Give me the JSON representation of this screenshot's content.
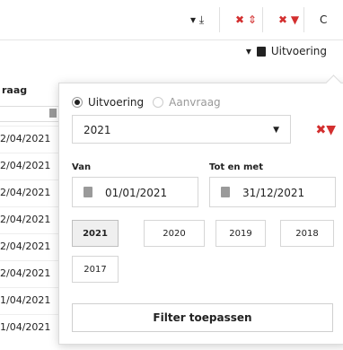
{
  "toolbar": {
    "export_icon_label": "▾ ⤓",
    "sort_icon_label": "✖ ⇕",
    "filter_icon_label": "✖ ▼",
    "refresh_icon_label": "C"
  },
  "subbar": {
    "dropdown_arrow": "▾",
    "calendar_icon": "calendar",
    "mode_label": "Uitvoering"
  },
  "grid": {
    "column_header": "raag",
    "rows": [
      "2/04/2021",
      "2/04/2021",
      "2/04/2021",
      "2/04/2021",
      "2/04/2021",
      "2/04/2021",
      "1/04/2021",
      "1/04/2021"
    ]
  },
  "popup": {
    "radio_options": [
      {
        "label": "Uitvoering",
        "selected": true
      },
      {
        "label": "Aanvraag",
        "selected": false
      }
    ],
    "year_select": {
      "value": "2021"
    },
    "clear_filter_label": "✖▼",
    "from_label": "Van",
    "to_label": "Tot en met",
    "from_date": "01/01/2021",
    "to_date": "31/12/2021",
    "year_buttons": [
      {
        "label": "2021",
        "active": true
      },
      {
        "label": "2020",
        "active": false
      },
      {
        "label": "2019",
        "active": false
      },
      {
        "label": "2018",
        "active": false
      },
      {
        "label": "2017",
        "active": false
      }
    ],
    "apply_label": "Filter toepassen"
  },
  "colors": {
    "accent_red": "#d32f2f",
    "border": "#d6d6d6"
  }
}
